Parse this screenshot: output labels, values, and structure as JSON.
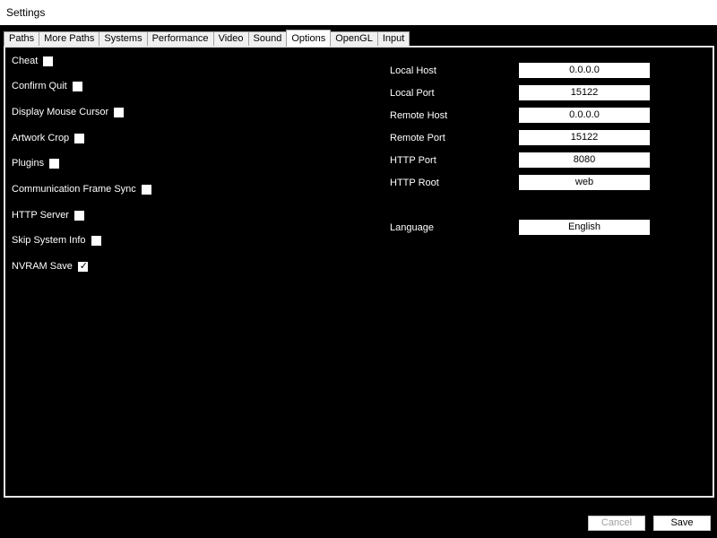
{
  "window": {
    "title": "Settings"
  },
  "tabs": [
    {
      "label": "Paths",
      "active": false
    },
    {
      "label": "More Paths",
      "active": false
    },
    {
      "label": "Systems",
      "active": false
    },
    {
      "label": "Performance",
      "active": false
    },
    {
      "label": "Video",
      "active": false
    },
    {
      "label": "Sound",
      "active": false
    },
    {
      "label": "Options",
      "active": true
    },
    {
      "label": "OpenGL",
      "active": false
    },
    {
      "label": "Input",
      "active": false
    }
  ],
  "options": {
    "checkboxes": [
      {
        "label": "Cheat",
        "checked": false
      },
      {
        "label": "Confirm Quit",
        "checked": false
      },
      {
        "label": "Display Mouse Cursor",
        "checked": false
      },
      {
        "label": "Artwork Crop",
        "checked": false
      },
      {
        "label": "Plugins",
        "checked": false
      },
      {
        "label": "Communication Frame Sync",
        "checked": false
      },
      {
        "label": "HTTP Server",
        "checked": false
      },
      {
        "label": "Skip System Info",
        "checked": false
      },
      {
        "label": "NVRAM Save",
        "checked": true
      }
    ],
    "fields": [
      {
        "label": "Local Host",
        "value": "0.0.0.0"
      },
      {
        "label": "Local Port",
        "value": "15122"
      },
      {
        "label": "Remote Host",
        "value": "0.0.0.0"
      },
      {
        "label": "Remote Port",
        "value": "15122"
      },
      {
        "label": "HTTP Port",
        "value": "8080"
      },
      {
        "label": "HTTP Root",
        "value": "web"
      },
      {
        "label": "Language",
        "value": "English"
      }
    ]
  },
  "buttons": {
    "cancel_label": "Cancel",
    "save_label": "Save"
  },
  "colors": {
    "background": "#000000",
    "panel_border": "#e6e6e6",
    "tab_background": "#f0f0f0"
  }
}
